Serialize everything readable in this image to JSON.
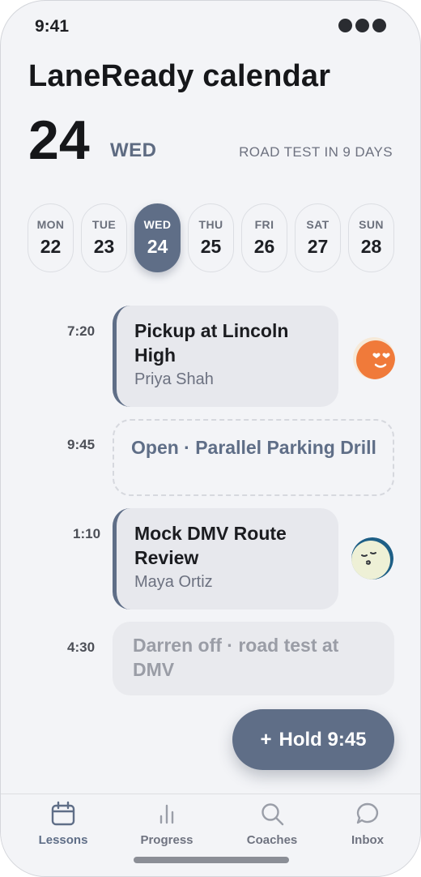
{
  "status": {
    "time": "9:41"
  },
  "header": {
    "title": "LaneReady calendar",
    "day_number": "24",
    "day_name": "WED",
    "countdown": "ROAD TEST IN 9 DAYS"
  },
  "week": {
    "days": [
      {
        "dow": "MON",
        "num": "22"
      },
      {
        "dow": "TUE",
        "num": "23"
      },
      {
        "dow": "WED",
        "num": "24"
      },
      {
        "dow": "THU",
        "num": "25"
      },
      {
        "dow": "FRI",
        "num": "26"
      },
      {
        "dow": "SAT",
        "num": "27"
      },
      {
        "dow": "SUN",
        "num": "28"
      }
    ],
    "selected": "WED 24"
  },
  "schedule": {
    "slots": [
      {
        "time": "7:20",
        "title": "Pickup at Lincoln High",
        "subtitle": "Priya Shah",
        "status": "booked"
      },
      {
        "time": "9:45",
        "title": "Open · Parallel Parking Drill",
        "status": "open"
      },
      {
        "time": "1:10",
        "title": "Mock DMV Route Review",
        "subtitle": "Maya Ortiz",
        "status": "booked"
      },
      {
        "time": "4:30",
        "title": "Darren off · road test at DMV",
        "status": "unavailable"
      }
    ]
  },
  "fab": {
    "icon": "+",
    "label": "Hold 9:45"
  },
  "tabs": [
    {
      "label": "Lessons",
      "icon": "calendar-icon",
      "active": true
    },
    {
      "label": "Progress",
      "icon": "bar-chart-icon",
      "active": false
    },
    {
      "label": "Coaches",
      "icon": "search-icon",
      "active": false
    },
    {
      "label": "Inbox",
      "icon": "chat-bubble-icon",
      "active": false
    }
  ],
  "colors": {
    "accent": "#5f6e87",
    "background": "#f3f4f7",
    "card": "#e7e8ed",
    "avatar_orange": "#f07a3a",
    "avatar_teal": "#1e5f86"
  }
}
